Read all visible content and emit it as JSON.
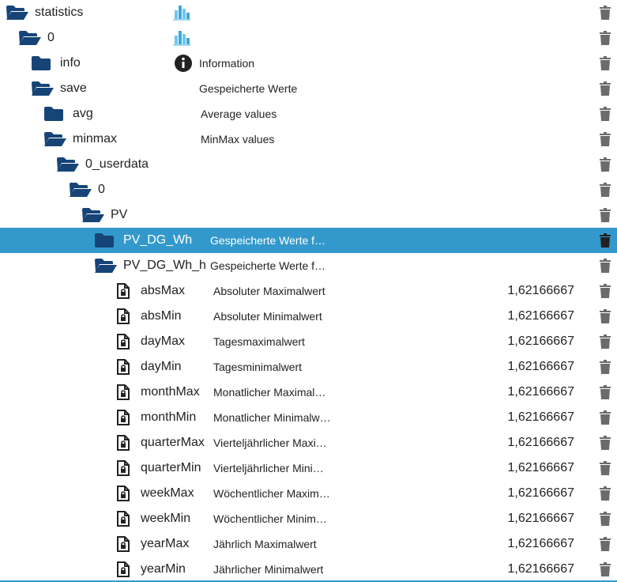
{
  "colors": {
    "folder": "#164477",
    "selected": "#3399cc",
    "trash": "#6b6b6b",
    "file": "#222222"
  },
  "rows": [
    {
      "name": "statistics",
      "level": 0,
      "icon": "folder-open-icon",
      "role": "chart-icon",
      "desc": "",
      "value": ""
    },
    {
      "name": "0",
      "level": 1,
      "icon": "folder-open-icon",
      "role": "chart-icon",
      "desc": "",
      "value": ""
    },
    {
      "name": "info",
      "level": 2,
      "icon": "folder-closed-icon",
      "role": "info-icon",
      "desc": "Information",
      "value": ""
    },
    {
      "name": "save",
      "level": 2,
      "icon": "folder-open-icon",
      "role": "",
      "desc": "Gespeicherte Werte",
      "value": ""
    },
    {
      "name": "avg",
      "level": 3,
      "icon": "folder-closed-icon",
      "role": "",
      "desc": "Average values",
      "value": ""
    },
    {
      "name": "minmax",
      "level": 3,
      "icon": "folder-open-icon",
      "role": "",
      "desc": "MinMax values",
      "value": ""
    },
    {
      "name": "0_userdata",
      "level": 4,
      "icon": "folder-open-icon",
      "role": "",
      "desc": "",
      "value": ""
    },
    {
      "name": "0",
      "level": 5,
      "icon": "folder-open-icon",
      "role": "",
      "desc": "",
      "value": ""
    },
    {
      "name": "PV",
      "level": 6,
      "icon": "folder-open-icon",
      "role": "",
      "desc": "",
      "value": ""
    },
    {
      "name": "PV_DG_Wh",
      "level": 7,
      "icon": "folder-closed-icon",
      "role": "",
      "desc": "Gespeicherte Werte f…",
      "value": "",
      "selected": true
    },
    {
      "name": "PV_DG_Wh_h",
      "level": 7,
      "icon": "folder-open-icon",
      "role": "",
      "desc": "Gespeicherte Werte f…",
      "value": ""
    },
    {
      "name": "absMax",
      "level": 8,
      "icon": "file-lock-icon",
      "role": "",
      "desc": "Absoluter Maximalwert",
      "value": "1,62166667"
    },
    {
      "name": "absMin",
      "level": 8,
      "icon": "file-lock-icon",
      "role": "",
      "desc": "Absoluter Minimalwert",
      "value": "1,62166667"
    },
    {
      "name": "dayMax",
      "level": 8,
      "icon": "file-lock-icon",
      "role": "",
      "desc": "Tagesmaximalwert",
      "value": "1,62166667"
    },
    {
      "name": "dayMin",
      "level": 8,
      "icon": "file-lock-icon",
      "role": "",
      "desc": "Tagesminimalwert",
      "value": "1,62166667"
    },
    {
      "name": "monthMax",
      "level": 8,
      "icon": "file-lock-icon",
      "role": "",
      "desc": "Monatlicher Maximal…",
      "value": "1,62166667"
    },
    {
      "name": "monthMin",
      "level": 8,
      "icon": "file-lock-icon",
      "role": "",
      "desc": "Monatlicher Minimalw…",
      "value": "1,62166667"
    },
    {
      "name": "quarterMax",
      "level": 8,
      "icon": "file-lock-icon",
      "role": "",
      "desc": "Vierteljährlicher Maxi…",
      "value": "1,62166667"
    },
    {
      "name": "quarterMin",
      "level": 8,
      "icon": "file-lock-icon",
      "role": "",
      "desc": "Vierteljährlicher Mini…",
      "value": "1,62166667"
    },
    {
      "name": "weekMax",
      "level": 8,
      "icon": "file-lock-icon",
      "role": "",
      "desc": "Wöchentlicher Maxim…",
      "value": "1,62166667"
    },
    {
      "name": "weekMin",
      "level": 8,
      "icon": "file-lock-icon",
      "role": "",
      "desc": "Wöchentlicher Minim…",
      "value": "1,62166667"
    },
    {
      "name": "yearMax",
      "level": 8,
      "icon": "file-lock-icon",
      "role": "",
      "desc": "Jährlich Maximalwert",
      "value": "1,62166667"
    },
    {
      "name": "yearMin",
      "level": 8,
      "icon": "file-lock-icon",
      "role": "",
      "desc": "Jährlicher Minimalwert",
      "value": "1,62166667"
    }
  ]
}
